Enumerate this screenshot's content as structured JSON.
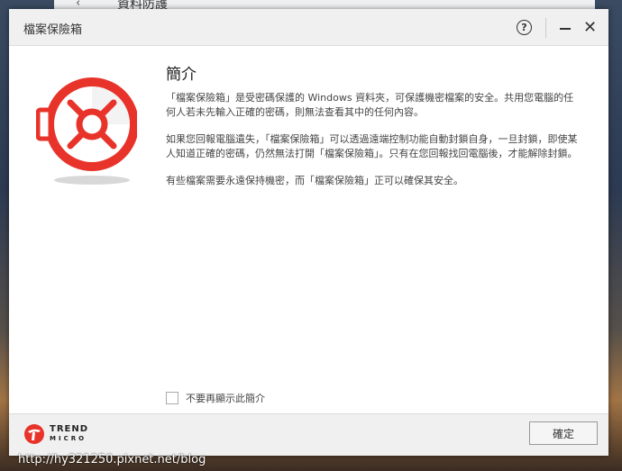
{
  "background_window": {
    "title": "資料防護",
    "back_icon": "chevron-left-icon"
  },
  "dialog": {
    "title": "檔案保險箱",
    "help_icon": "question-circle-icon",
    "help_label": "?",
    "min_icon": "minimize-icon",
    "close_icon": "close-icon",
    "close_label": "✕"
  },
  "main": {
    "icon": "vault-safe-icon",
    "heading": "簡介",
    "paragraphs": [
      "「檔案保險箱」是受密碼保護的 Windows 資料夾，可保護機密檔案的安全。共用您電腦的任何人若未先輸入正確的密碼，則無法查看其中的任何內容。",
      "如果您回報電腦遺失，「檔案保險箱」可以透過遠端控制功能自動封鎖自身，一旦封鎖，即使某人知道正確的密碼，仍然無法打開「檔案保險箱」。只有在您回報找回電腦後，才能解除封鎖。",
      "有些檔案需要永遠保持機密，而「檔案保險箱」正可以確保其安全。"
    ],
    "checkbox_label": "不要再顯示此簡介",
    "checkbox_checked": false
  },
  "footer": {
    "brand_line1": "TREND",
    "brand_line2": "MICRO",
    "brand_icon": "trend-micro-logo-icon",
    "ok_label": "確定"
  },
  "watermark": "http://hy321250.pixnet.net/blog",
  "colors": {
    "accent_red": "#e8332a",
    "titlebar_bg": "#f0f0f0"
  }
}
